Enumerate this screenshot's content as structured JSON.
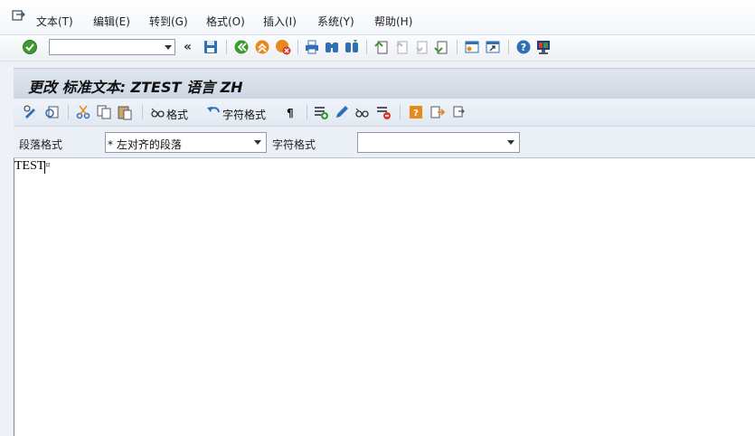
{
  "menu": {
    "items": [
      "文本(T)",
      "编辑(E)",
      "转到(G)",
      "格式(O)",
      "插入(I)",
      "系统(Y)",
      "帮助(H)"
    ]
  },
  "toolbar": {
    "command_field_value": "",
    "icons": [
      "confirm-icon",
      "command-dropdown",
      "collapse-icon",
      "save-icon",
      "back-icon",
      "exit-icon",
      "cancel-icon",
      "print-icon",
      "find-icon",
      "find-next-icon",
      "first-page-icon",
      "previous-page-icon",
      "next-page-icon",
      "last-page-icon",
      "create-session-icon",
      "shortcut-icon",
      "help-icon",
      "customize-layout-icon"
    ]
  },
  "title": {
    "text": "更改 标准文本: ZTEST 语言 ZH"
  },
  "app_toolbar": {
    "format_label": "格式",
    "char_format_label": "字符格式",
    "paragraph_mark": "¶"
  },
  "format_row": {
    "paragraph_label": "段落格式",
    "paragraph_value": "* 左对齐的段落",
    "char_label": "字符格式",
    "char_value": ""
  },
  "editor": {
    "text": "TEST",
    "end_mark": "¤"
  },
  "colors": {
    "accent_green": "#3b9a2f",
    "accent_orange": "#e8891c",
    "accent_red": "#d83b2b",
    "icon_blue": "#2f6fb5"
  }
}
